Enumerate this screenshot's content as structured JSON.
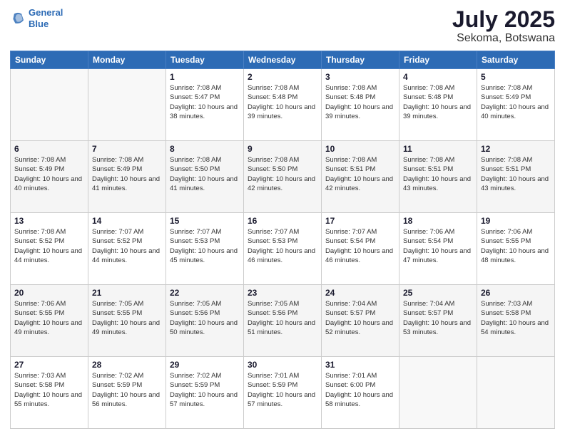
{
  "header": {
    "logo_line1": "General",
    "logo_line2": "Blue",
    "title": "July 2025",
    "subtitle": "Sekoma, Botswana"
  },
  "days_of_week": [
    "Sunday",
    "Monday",
    "Tuesday",
    "Wednesday",
    "Thursday",
    "Friday",
    "Saturday"
  ],
  "weeks": [
    [
      {
        "num": "",
        "info": ""
      },
      {
        "num": "",
        "info": ""
      },
      {
        "num": "1",
        "sunrise": "7:08 AM",
        "sunset": "5:47 PM",
        "daylight": "10 hours and 38 minutes."
      },
      {
        "num": "2",
        "sunrise": "7:08 AM",
        "sunset": "5:48 PM",
        "daylight": "10 hours and 39 minutes."
      },
      {
        "num": "3",
        "sunrise": "7:08 AM",
        "sunset": "5:48 PM",
        "daylight": "10 hours and 39 minutes."
      },
      {
        "num": "4",
        "sunrise": "7:08 AM",
        "sunset": "5:48 PM",
        "daylight": "10 hours and 39 minutes."
      },
      {
        "num": "5",
        "sunrise": "7:08 AM",
        "sunset": "5:49 PM",
        "daylight": "10 hours and 40 minutes."
      }
    ],
    [
      {
        "num": "6",
        "sunrise": "7:08 AM",
        "sunset": "5:49 PM",
        "daylight": "10 hours and 40 minutes."
      },
      {
        "num": "7",
        "sunrise": "7:08 AM",
        "sunset": "5:49 PM",
        "daylight": "10 hours and 41 minutes."
      },
      {
        "num": "8",
        "sunrise": "7:08 AM",
        "sunset": "5:50 PM",
        "daylight": "10 hours and 41 minutes."
      },
      {
        "num": "9",
        "sunrise": "7:08 AM",
        "sunset": "5:50 PM",
        "daylight": "10 hours and 42 minutes."
      },
      {
        "num": "10",
        "sunrise": "7:08 AM",
        "sunset": "5:51 PM",
        "daylight": "10 hours and 42 minutes."
      },
      {
        "num": "11",
        "sunrise": "7:08 AM",
        "sunset": "5:51 PM",
        "daylight": "10 hours and 43 minutes."
      },
      {
        "num": "12",
        "sunrise": "7:08 AM",
        "sunset": "5:51 PM",
        "daylight": "10 hours and 43 minutes."
      }
    ],
    [
      {
        "num": "13",
        "sunrise": "7:08 AM",
        "sunset": "5:52 PM",
        "daylight": "10 hours and 44 minutes."
      },
      {
        "num": "14",
        "sunrise": "7:07 AM",
        "sunset": "5:52 PM",
        "daylight": "10 hours and 44 minutes."
      },
      {
        "num": "15",
        "sunrise": "7:07 AM",
        "sunset": "5:53 PM",
        "daylight": "10 hours and 45 minutes."
      },
      {
        "num": "16",
        "sunrise": "7:07 AM",
        "sunset": "5:53 PM",
        "daylight": "10 hours and 46 minutes."
      },
      {
        "num": "17",
        "sunrise": "7:07 AM",
        "sunset": "5:54 PM",
        "daylight": "10 hours and 46 minutes."
      },
      {
        "num": "18",
        "sunrise": "7:06 AM",
        "sunset": "5:54 PM",
        "daylight": "10 hours and 47 minutes."
      },
      {
        "num": "19",
        "sunrise": "7:06 AM",
        "sunset": "5:55 PM",
        "daylight": "10 hours and 48 minutes."
      }
    ],
    [
      {
        "num": "20",
        "sunrise": "7:06 AM",
        "sunset": "5:55 PM",
        "daylight": "10 hours and 49 minutes."
      },
      {
        "num": "21",
        "sunrise": "7:05 AM",
        "sunset": "5:55 PM",
        "daylight": "10 hours and 49 minutes."
      },
      {
        "num": "22",
        "sunrise": "7:05 AM",
        "sunset": "5:56 PM",
        "daylight": "10 hours and 50 minutes."
      },
      {
        "num": "23",
        "sunrise": "7:05 AM",
        "sunset": "5:56 PM",
        "daylight": "10 hours and 51 minutes."
      },
      {
        "num": "24",
        "sunrise": "7:04 AM",
        "sunset": "5:57 PM",
        "daylight": "10 hours and 52 minutes."
      },
      {
        "num": "25",
        "sunrise": "7:04 AM",
        "sunset": "5:57 PM",
        "daylight": "10 hours and 53 minutes."
      },
      {
        "num": "26",
        "sunrise": "7:03 AM",
        "sunset": "5:58 PM",
        "daylight": "10 hours and 54 minutes."
      }
    ],
    [
      {
        "num": "27",
        "sunrise": "7:03 AM",
        "sunset": "5:58 PM",
        "daylight": "10 hours and 55 minutes."
      },
      {
        "num": "28",
        "sunrise": "7:02 AM",
        "sunset": "5:59 PM",
        "daylight": "10 hours and 56 minutes."
      },
      {
        "num": "29",
        "sunrise": "7:02 AM",
        "sunset": "5:59 PM",
        "daylight": "10 hours and 57 minutes."
      },
      {
        "num": "30",
        "sunrise": "7:01 AM",
        "sunset": "5:59 PM",
        "daylight": "10 hours and 57 minutes."
      },
      {
        "num": "31",
        "sunrise": "7:01 AM",
        "sunset": "6:00 PM",
        "daylight": "10 hours and 58 minutes."
      },
      {
        "num": "",
        "info": ""
      },
      {
        "num": "",
        "info": ""
      }
    ]
  ]
}
